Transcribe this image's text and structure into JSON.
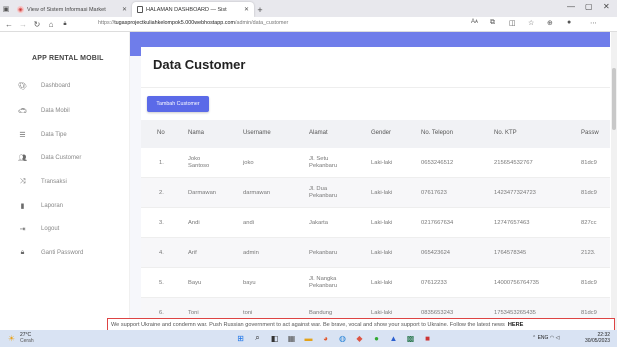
{
  "browser": {
    "tabs": [
      {
        "title": "View of Sistem Informasi Market",
        "active": false
      },
      {
        "title": "HALAMAN DASHBOARD — Sist",
        "active": true
      }
    ],
    "url_prefix": "https://",
    "url_domain": "tugasprojectkuliahkelompok5.000webhostapp.com",
    "url_path": "/admin/data_customer",
    "reader_label": "Aᴀ"
  },
  "sidebar": {
    "brand": "APP RENTAL MOBIL",
    "items": [
      {
        "label": "Dashboard",
        "icon": "palette-icon"
      },
      {
        "label": "Data Mobil",
        "icon": "car-icon"
      },
      {
        "label": "Data Tipe",
        "icon": "list-icon"
      },
      {
        "label": "Data Customer",
        "icon": "users-icon"
      },
      {
        "label": "Transaksi",
        "icon": "random-icon"
      },
      {
        "label": "Laporan",
        "icon": "document-icon"
      },
      {
        "label": "Logout",
        "icon": "sign-out-icon"
      },
      {
        "label": "Ganti Password",
        "icon": "lock-icon"
      }
    ]
  },
  "main": {
    "title": "Data Customer",
    "add_button": "Tambah Customer",
    "columns": [
      "No",
      "Nama",
      "Username",
      "Alamat",
      "Gender",
      "No. Telepon",
      "No. KTP",
      "Passw"
    ],
    "rows": [
      {
        "no": "1.",
        "nama": [
          "Joko",
          "Santoso"
        ],
        "username": "joko",
        "alamat": [
          "Jl. Setu",
          "Pekanbaru"
        ],
        "gender": "Laki-laki",
        "telepon": "0653246512",
        "ktp": "215654532767",
        "pass": "81dc9"
      },
      {
        "no": "2.",
        "nama": [
          "Darmawan"
        ],
        "username": "darmawan",
        "alamat": [
          "Jl. Dua",
          "Pekanbaru"
        ],
        "gender": "Laki-laki",
        "telepon": "07617623",
        "ktp": "1423477324723",
        "pass": "81dc9"
      },
      {
        "no": "3.",
        "nama": [
          "Andi"
        ],
        "username": "andi",
        "alamat": [
          "Jakarta"
        ],
        "gender": "Laki-laki",
        "telepon": "0217667634",
        "ktp": "12747657463",
        "pass": "827cc"
      },
      {
        "no": "4.",
        "nama": [
          "Arif"
        ],
        "username": "admin",
        "alamat": [
          "Pekanbaru"
        ],
        "gender": "Laki-laki",
        "telepon": "065423624",
        "ktp": "1764578345",
        "pass": "2123."
      },
      {
        "no": "5.",
        "nama": [
          "Bayu"
        ],
        "username": "bayu",
        "alamat": [
          "Jl. Nangka",
          "Pekanbaru"
        ],
        "gender": "Laki-laki",
        "telepon": "07612233",
        "ktp": "14000756764735",
        "pass": "81dc9"
      },
      {
        "no": "6.",
        "nama": [
          "Toni"
        ],
        "username": "toni",
        "alamat": [
          "Bandung"
        ],
        "gender": "Laki-laki",
        "telepon": "0835653243",
        "ktp": "1753453265435",
        "pass": "81dc9"
      }
    ]
  },
  "banner": {
    "text": "We support Ukraine and condemn war. Push Russian government to act against war. Be brave, vocal and show your support to Ukraine. Follow the latest news",
    "link": "HERE"
  },
  "taskbar": {
    "temperature": "27°C",
    "weather": "Cerah",
    "lang": "ENG",
    "time": "22:32",
    "date": "30/05/2023"
  },
  "colors": {
    "accent": "#6f7dea",
    "button": "#5b6ae8",
    "banner_border": "#dd4444",
    "taskbar": "#d9e3f3"
  }
}
